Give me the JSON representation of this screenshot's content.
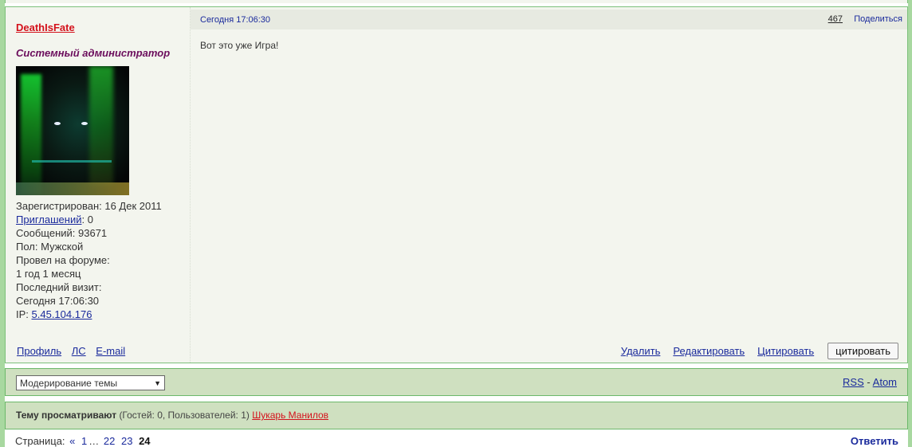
{
  "post": {
    "username": "DeathIsFate",
    "rank": "Системный администратор",
    "avatar_icon": "user-avatar-image",
    "info": {
      "registered": "Зарегистрирован: 16 Дек 2011",
      "invites_label": "Приглашений",
      "invites_value": ": 0",
      "messages": "Сообщений: 93671",
      "gender": "Пол: Мужской",
      "forum_time_label": "Провел на форуме:",
      "forum_time_value": "1 год 1 месяц",
      "last_visit_label": "Последний визит:",
      "last_visit_value": "Сегодня 17:06:30",
      "ip_label": "IP: ",
      "ip_value": "5.45.104.176"
    },
    "user_links": [
      "Профиль",
      "ЛС",
      "E-mail"
    ],
    "date": "Сегодня 17:06:30",
    "number": "467",
    "share": "Поделиться",
    "text": "Вот это уже Игра!",
    "actions": {
      "delete": "Удалить",
      "edit": "Редактировать",
      "quote": "Цитировать",
      "quote_button": "цитировать"
    }
  },
  "moderation": {
    "select_value": "Модерирование темы",
    "rss": "RSS",
    "separator": "-",
    "atom": "Atom"
  },
  "viewers": {
    "label": "Тему просматривают",
    "counts": "(Гостей: 0, Пользователей: 1)",
    "user": "Шукарь Манилов"
  },
  "pager": {
    "label": "Страница:",
    "prev": "«",
    "pages": [
      "1",
      "…",
      "22",
      "23"
    ],
    "current": "24",
    "reply": "Ответить"
  },
  "colors": {
    "outer_bg": "#a8d8a0",
    "bar_bg": "#cfe0c0",
    "link": "#1a2a9c",
    "username": "#d4121c",
    "rank": "#6b0d5c"
  }
}
